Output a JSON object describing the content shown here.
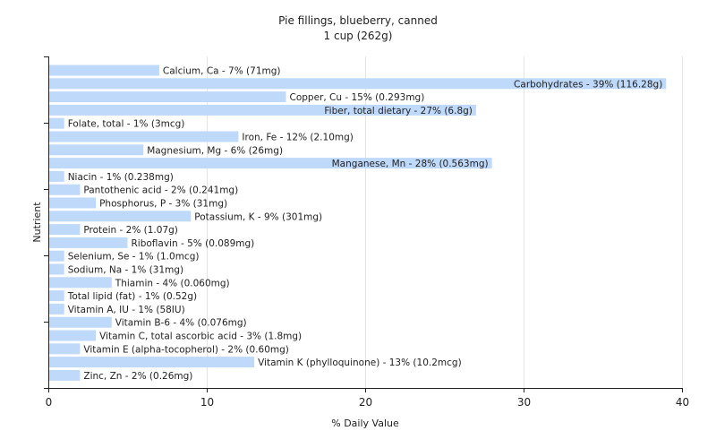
{
  "chart_data": {
    "type": "bar",
    "orientation": "horizontal",
    "title": "Pie fillings, blueberry, canned",
    "subtitle": "1 cup (262g)",
    "xlabel": "% Daily Value",
    "ylabel": "Nutrient",
    "xlim": [
      0,
      40
    ],
    "xticks": [
      0,
      10,
      20,
      30,
      40
    ],
    "grid": true,
    "bar_color": "#bfd9fb",
    "categories": [
      "Calcium, Ca",
      "Carbohydrates",
      "Copper, Cu",
      "Fiber, total dietary",
      "Folate, total",
      "Iron, Fe",
      "Magnesium, Mg",
      "Manganese, Mn",
      "Niacin",
      "Pantothenic acid",
      "Phosphorus, P",
      "Potassium, K",
      "Protein",
      "Riboflavin",
      "Selenium, Se",
      "Sodium, Na",
      "Thiamin",
      "Total lipid (fat)",
      "Vitamin A, IU",
      "Vitamin B-6",
      "Vitamin C, total ascorbic acid",
      "Vitamin E (alpha-tocopherol)",
      "Vitamin K (phylloquinone)",
      "Zinc, Zn"
    ],
    "values": [
      7,
      39,
      15,
      27,
      1,
      12,
      6,
      28,
      1,
      2,
      3,
      9,
      2,
      5,
      1,
      1,
      4,
      1,
      1,
      4,
      3,
      2,
      13,
      2
    ],
    "labels": [
      "Calcium, Ca - 7% (71mg)",
      "Carbohydrates - 39% (116.28g)",
      "Copper, Cu - 15% (0.293mg)",
      "Fiber, total dietary - 27% (6.8g)",
      "Folate, total - 1% (3mcg)",
      "Iron, Fe - 12% (2.10mg)",
      "Magnesium, Mg - 6% (26mg)",
      "Manganese, Mn - 28% (0.563mg)",
      "Niacin - 1% (0.238mg)",
      "Pantothenic acid - 2% (0.241mg)",
      "Phosphorus, P - 3% (31mg)",
      "Potassium, K - 9% (301mg)",
      "Protein - 2% (1.07g)",
      "Riboflavin - 5% (0.089mg)",
      "Selenium, Se - 1% (1.0mcg)",
      "Sodium, Na - 1% (31mg)",
      "Thiamin - 4% (0.060mg)",
      "Total lipid (fat) - 1% (0.52g)",
      "Vitamin A, IU - 1% (58IU)",
      "Vitamin B-6 - 4% (0.076mg)",
      "Vitamin C, total ascorbic acid - 3% (1.8mg)",
      "Vitamin E (alpha-tocopherol) - 2% (0.60mg)",
      "Vitamin K (phylloquinone) - 13% (10.2mcg)",
      "Zinc, Zn - 2% (0.26mg)"
    ]
  }
}
